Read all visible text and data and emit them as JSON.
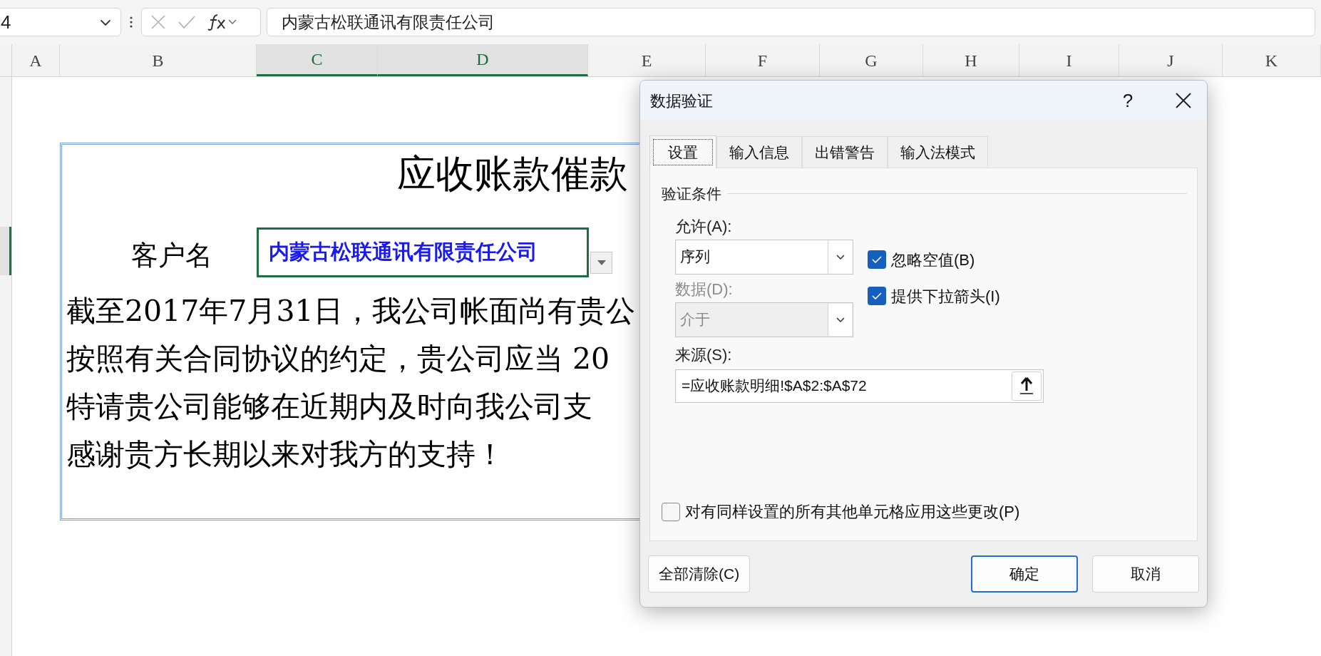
{
  "formula_bar": {
    "name_box": "4",
    "formula": "内蒙古松联通讯有限责任公司"
  },
  "column_headers": [
    {
      "label": "A",
      "selected": false
    },
    {
      "label": "B",
      "selected": false
    },
    {
      "label": "C",
      "selected": true
    },
    {
      "label": "D",
      "selected": true
    },
    {
      "label": "E",
      "selected": false
    },
    {
      "label": "F",
      "selected": false
    },
    {
      "label": "G",
      "selected": false
    },
    {
      "label": "H",
      "selected": false
    },
    {
      "label": "I",
      "selected": false
    },
    {
      "label": "J",
      "selected": false
    },
    {
      "label": "K",
      "selected": false
    }
  ],
  "sheet": {
    "title": "应收账款催款",
    "customer_label": "客户名",
    "cell_editor": {
      "value": "内蒙古松联通讯有限责任公司",
      "dropdown": true
    },
    "paragraph_lines": [
      "截至2017年7月31日，我公司帐面尚有贵公",
      "按照有关合同协议的约定，贵公司应当 20",
      "特请贵公司能够在近期内及时向我公司支",
      "感谢贵方长期以来对我方的支持！"
    ]
  },
  "dialog": {
    "title": "数据验证",
    "help": "?",
    "tabs": [
      {
        "label": "设置",
        "selected": true
      },
      {
        "label": "输入信息",
        "selected": false
      },
      {
        "label": "出错警告",
        "selected": false
      },
      {
        "label": "输入法模式",
        "selected": false
      }
    ],
    "section": "验证条件",
    "selects": [
      {
        "label": "允许(A):",
        "value": "序列",
        "disabled": false
      },
      {
        "label": "数据(D):",
        "value": "介于",
        "disabled": true
      }
    ],
    "checkboxes": [
      {
        "label": "忽略空值(B)",
        "checked": true
      },
      {
        "label": "提供下拉箭头(I)",
        "checked": true
      }
    ],
    "source": {
      "label": "来源(S):",
      "value": "=应收账款明细!$A$2:$A$72"
    },
    "apply_all": {
      "label": "对有同样设置的所有其他单元格应用这些更改(P)",
      "checked": false
    },
    "buttons": [
      {
        "label": "全部清除(C)",
        "default": false
      },
      {
        "label": "确定",
        "default": true
      },
      {
        "label": "取消",
        "default": false
      }
    ]
  }
}
